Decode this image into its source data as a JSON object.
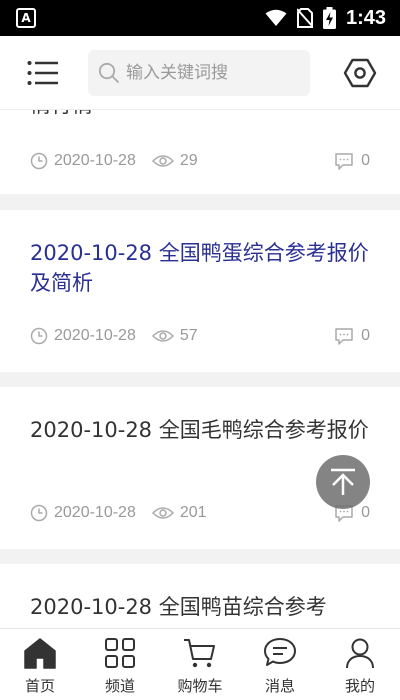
{
  "status": {
    "badge": "A",
    "time": "1:43"
  },
  "header": {
    "search_placeholder": "输入关键词搜",
    "menu_icon": "menu-icon",
    "settings_icon": "hexagon-settings-icon"
  },
  "articles": [
    {
      "title": "情行情",
      "date": "2020-10-28",
      "views": "29",
      "comments": "0"
    },
    {
      "title": "2020-10-28 全国鸭蛋综合参考报价及简析",
      "date": "2020-10-28",
      "views": "57",
      "comments": "0",
      "highlighted": true
    },
    {
      "title": "2020-10-28 全国毛鸭综合参考报价",
      "date": "2020-10-28",
      "views": "201",
      "comments": "0"
    },
    {
      "title": "2020-10-28 全国鸭苗综合参考",
      "date": "",
      "views": "",
      "comments": ""
    }
  ],
  "back_to_top_icon": "arrow-up-to-top-icon",
  "nav": [
    {
      "label": "首页",
      "icon": "home-icon",
      "active": true
    },
    {
      "label": "频道",
      "icon": "grid-icon"
    },
    {
      "label": "购物车",
      "icon": "cart-icon"
    },
    {
      "label": "消息",
      "icon": "message-icon"
    },
    {
      "label": "我的",
      "icon": "user-icon"
    }
  ],
  "colors": {
    "highlight_title": "#2a2f93",
    "meta": "#999999",
    "background": "#f2f2f2"
  }
}
